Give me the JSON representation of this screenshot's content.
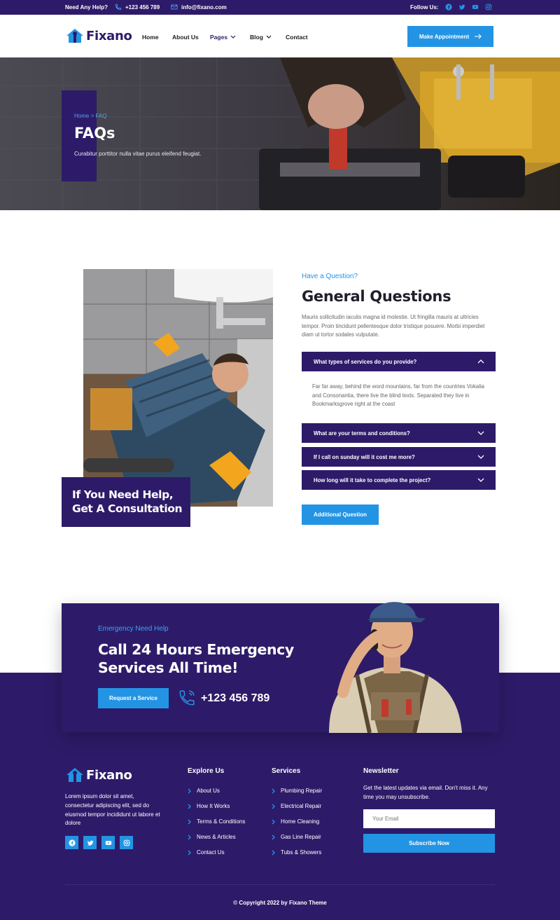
{
  "topbar": {
    "need_help": "Need Any Help?",
    "phone": "+123 456 789",
    "email": "info@fixano.com",
    "follow": "Follow Us:",
    "socials": [
      "facebook-icon",
      "twitter-icon",
      "youtube-icon",
      "instagram-icon"
    ]
  },
  "brand": {
    "name": "Fixano"
  },
  "nav": {
    "items": [
      "Home",
      "About Us",
      "Pages",
      "Blog",
      "Contact"
    ],
    "active": "Pages",
    "cta_label": "Make Appointment"
  },
  "hero": {
    "crumb_home": "Home",
    "crumb_sep": " > ",
    "crumb_current": "FAQ",
    "title": "FAQs",
    "subtitle": "Curabitur porttitor nulla vitae purus eleifend feugiat."
  },
  "faq": {
    "consult_line1": "If You Need Help,",
    "consult_line2": "Get A Consultation",
    "kicker": "Have a Question?",
    "title": "General Questions",
    "intro": "Mauris sollicitudin iaculis magna id molestie. Ut fringilla mauris at ultricies tempor. Proin tincidunt pellentesque dolor tristique posuere. Morbi imperdiet diam ut tortor sodales vulputate.",
    "items": [
      {
        "question": "What types of services do you provide?",
        "open": true
      },
      {
        "question": "What are your terms and conditions?",
        "open": false
      },
      {
        "question": "If I call on sunday will it cost me more?",
        "open": false
      },
      {
        "question": "How long will it take to complete the project?",
        "open": false
      }
    ],
    "answer": "Far far away, behind the word mountains, far from the countries Vokalia and Consonantia, there live the blind texts. Separated they live in Bookmarksgrove right at the coast",
    "more_button": "Additional Question"
  },
  "cta": {
    "kicker": "Emergency Need Help",
    "title_line1": "Call 24 Hours Emergency",
    "title_line2": "Services All Time!",
    "button": "Request a Service",
    "phone": "+123 456 789"
  },
  "footer": {
    "about": "Lorem ipsum dolor sit amet, consectetur adipiscing elit, sed do eiusmod tempor incididunt ut labore et dolore",
    "explore_title": "Explore Us",
    "explore": [
      "About Us",
      "How It Works",
      "Terms & Conditions",
      "News & Articles",
      "Contact Us"
    ],
    "services_title": "Services",
    "services": [
      "Plumbing Repair",
      "Electrical Repair",
      "Home Cleaning",
      "Gas Line Repair",
      "Tubs & Showers"
    ],
    "newsletter_title": "Newsletter",
    "newsletter_text": "Get the latest updates via email. Don't miss it. Any time you may unsubscribe.",
    "email_placeholder": "Your Email",
    "subscribe": "Subscribe Now",
    "copyright": "© Copyright 2022 by Fixano Theme"
  },
  "colors": {
    "primary": "#2d1b69",
    "accent": "#2394e4"
  }
}
